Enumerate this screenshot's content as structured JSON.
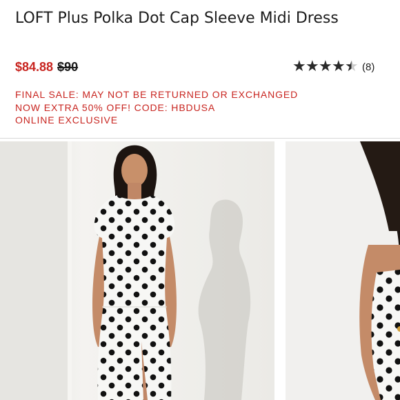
{
  "product": {
    "title": "LOFT Plus Polka Dot Cap Sleeve Midi Dress",
    "sale_price": "$84.88",
    "original_price": "$90",
    "rating": {
      "value": 4.5,
      "max": 5,
      "count_label": "(8)"
    },
    "promos": [
      "FINAL SALE: MAY NOT BE RETURNED OR EXCHANGED",
      "NOW EXTRA 50% OFF! CODE: HBDUSA",
      "ONLINE EXCLUSIVE"
    ]
  },
  "colors": {
    "sale_red": "#c8241f",
    "text": "#1b1b1b",
    "star_filled": "#2a2a2a",
    "star_empty": "#cccccc"
  },
  "icons": [
    "star-icon",
    "half-star-icon"
  ]
}
